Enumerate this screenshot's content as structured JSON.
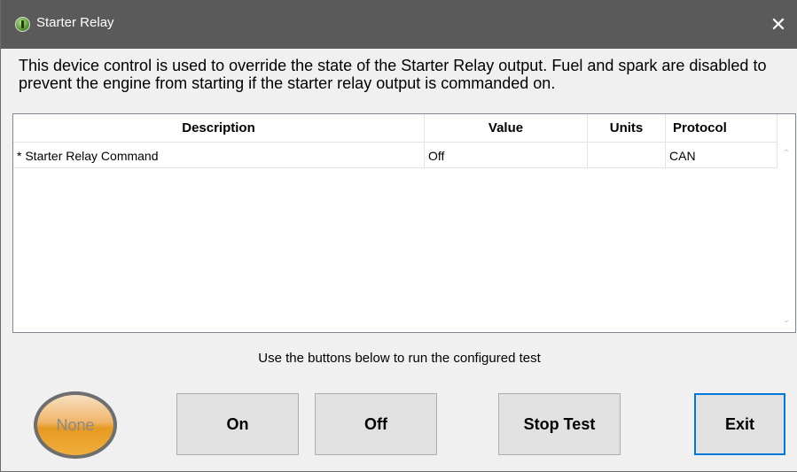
{
  "window": {
    "title": "Starter Relay",
    "close_glyph": "✕",
    "app_icon": "app-logo-icon"
  },
  "description": "This device control is used to override the state of the Starter Relay output.  Fuel and spark are disabled to prevent the engine from starting if the starter relay output is commanded on.",
  "table": {
    "headers": {
      "description": "Description",
      "value": "Value",
      "units": "Units",
      "protocol": "Protocol"
    },
    "rows": [
      {
        "description": "* Starter Relay Command",
        "value": "Off",
        "units": "",
        "protocol": "CAN"
      }
    ]
  },
  "hint": "Use the buttons below to run the configured test",
  "indicator": {
    "label": "None",
    "color": "#e69a22"
  },
  "buttons": {
    "on": "On",
    "off": "Off",
    "stop": "Stop Test",
    "exit": "Exit"
  }
}
